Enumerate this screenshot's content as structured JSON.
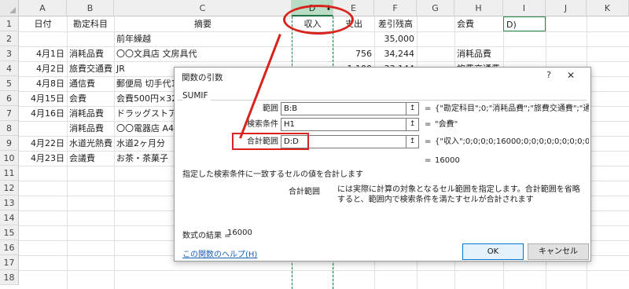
{
  "sheet": {
    "columns": [
      "A",
      "B",
      "C",
      "D",
      "E",
      "F",
      "G",
      "H",
      "I",
      "J",
      "K"
    ],
    "rows": [
      "1",
      "2",
      "3",
      "4",
      "5",
      "6",
      "7",
      "8",
      "9",
      "10",
      "11",
      "12",
      "13",
      "14",
      "15",
      "16",
      "17",
      "18"
    ],
    "row1": {
      "A": "日付",
      "B": "勘定科目",
      "C": "摘要",
      "D": "収入",
      "E": "支出",
      "F": "差引残高",
      "H": "会費",
      "I": "D)"
    },
    "row2": {
      "C": "前年繰越",
      "F": "35,000"
    },
    "row3": {
      "A": "4月1日",
      "B": "消耗品費",
      "C": "〇〇文具店 文房具代",
      "E": "756",
      "F": "34,244",
      "H": "消耗品費"
    },
    "row4": {
      "A": "4月2日",
      "B": "旅費交通費",
      "C": "JR",
      "E": "1,100",
      "F": "33,144",
      "H": "旅費交通費"
    },
    "row5": {
      "A": "4月8日",
      "B": "通信費",
      "C": "郵便局 切手代1"
    },
    "row6": {
      "A": "4月15日",
      "B": "会費",
      "C": "会費500円×32"
    },
    "row7": {
      "A": "4月16日",
      "B": "消耗品費",
      "C": "ドラッグストア"
    },
    "row8": {
      "B": "消耗品費",
      "C": "〇〇電器店 A4"
    },
    "row9": {
      "A": "4月22日",
      "B": "水道光熱費",
      "C": "水道2ヶ月分"
    },
    "row10": {
      "A": "4月23日",
      "B": "会議費",
      "C": "お茶・茶菓子"
    }
  },
  "dialog": {
    "title": "関数の引数",
    "help_glyph": "?",
    "close_glyph": "✕",
    "function_name": "SUMIF",
    "args": [
      {
        "label": "範囲",
        "value": "B:B",
        "result": "{\"勘定科目\";0;\"消耗品費\";\"旅費交通費\";\"通"
      },
      {
        "label": "検索条件",
        "value": "H1",
        "result": "\"会費\""
      },
      {
        "label": "合計範囲",
        "value": "D:D",
        "result": "{\"収入\";0;0;0;0;16000;0;0;0;0;0;0;0;0;0;0;0"
      }
    ],
    "ref_glyph": "↥",
    "equals": "=",
    "function_result": "16000",
    "description": "指定した検索条件に一致するセルの値を合計します",
    "arg_desc_name": "合計範囲",
    "arg_desc_text": "には実際に計算の対象となるセル範囲を指定します。合計範囲を省略すると、範囲内で検索条件を満たすセルが合計されます",
    "formula_result_label": "数式の結果 =",
    "formula_result_value": "16000",
    "help_link": "この関数のヘルプ(H)",
    "ok_label": "OK",
    "cancel_label": "キャンセル"
  }
}
